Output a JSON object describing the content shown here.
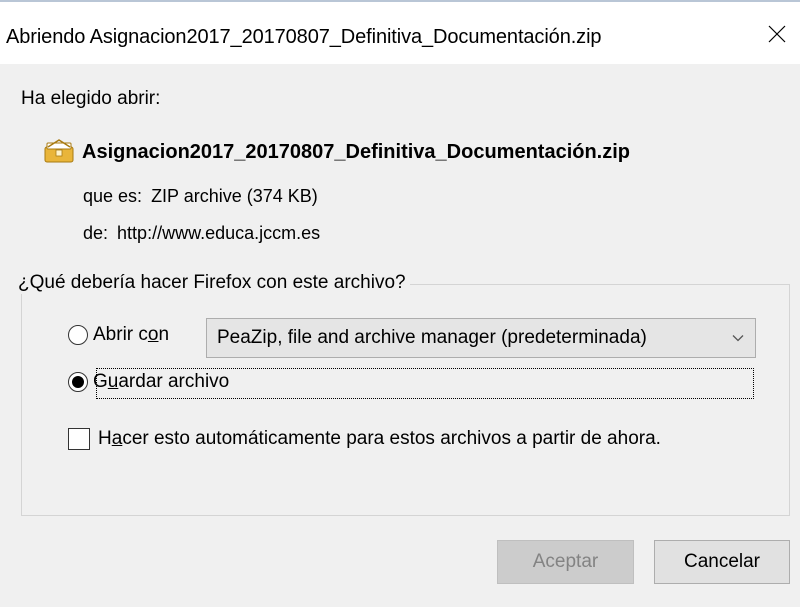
{
  "window": {
    "title": "Abriendo Asignacion2017_20170807_Definitiva_Documentación.zip",
    "close_glyph": "close-icon"
  },
  "dialog": {
    "intro": "Ha elegido abrir:",
    "file_icon": "zip-archive-icon",
    "filename": "Asignacion2017_20170807_Definitiva_Documentación.zip",
    "type_label": "que es:",
    "type_value": "ZIP archive (374 KB)",
    "from_label": "de:",
    "from_value": "http://www.educa.jccm.es"
  },
  "action_group": {
    "legend": "¿Qué debería hacer Firefox con este archivo?",
    "open_with": {
      "label_pre": "Abrir c",
      "label_accel": "o",
      "label_post": "n",
      "selected": false,
      "app_selected": "PeaZip, file and archive manager (predeterminada)"
    },
    "save": {
      "label_pre": "G",
      "label_accel": "u",
      "label_post": "ardar archivo",
      "selected": true
    },
    "auto": {
      "label_pre": "H",
      "label_accel": "a",
      "label_post": "cer esto automáticamente para estos archivos a partir de ahora.",
      "checked": false
    }
  },
  "buttons": {
    "ok": "Aceptar",
    "ok_enabled": false,
    "cancel": "Cancelar"
  },
  "colors": {
    "background": "#f0f0f0",
    "titlebar": "#ffffff",
    "button_bg": "#e1e1e1",
    "disabled_text": "#838383"
  }
}
